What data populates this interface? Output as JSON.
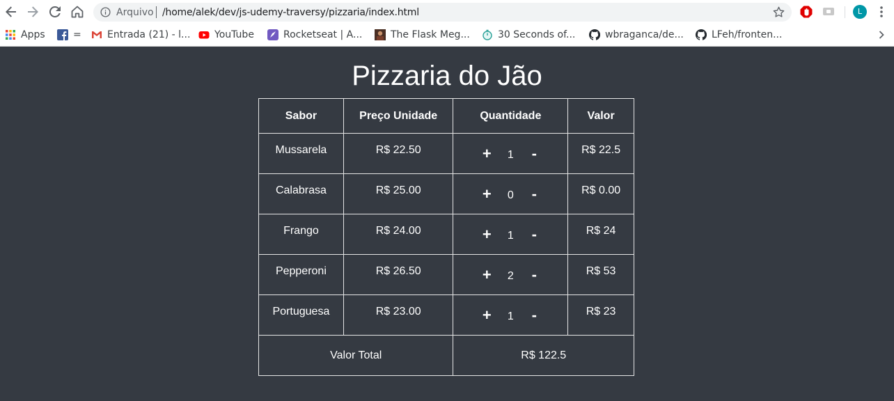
{
  "browser": {
    "omnibox_label": "Arquivo",
    "url": "/home/alek/dev/js-udemy-traversy/pizzaria/index.html",
    "profile_initial": "L",
    "bookmarks": [
      {
        "label": "Apps",
        "icon": "apps-grid-icon"
      },
      {
        "label": "=",
        "icon": "facebook-icon"
      },
      {
        "label": "Entrada (21) - l...",
        "icon": "gmail-icon"
      },
      {
        "label": "YouTube",
        "icon": "youtube-icon"
      },
      {
        "label": "Rocketseat | A...",
        "icon": "rocketseat-icon"
      },
      {
        "label": "The Flask Meg...",
        "icon": "flask-mega-icon"
      },
      {
        "label": "30 Seconds of...",
        "icon": "stopwatch-icon"
      },
      {
        "label": "wbraganca/de...",
        "icon": "github-icon"
      },
      {
        "label": "LFeh/fronten...",
        "icon": "github-icon"
      }
    ]
  },
  "page": {
    "title": "Pizzaria do Jão",
    "headers": {
      "sabor": "Sabor",
      "preco": "Preço Unidade",
      "quantidade": "Quantidade",
      "valor": "Valor"
    },
    "plus_label": "+",
    "minus_label": "-",
    "rows": [
      {
        "sabor": "Mussarela",
        "preco": "R$ 22.50",
        "quantidade": "1",
        "valor": "R$ 22.5"
      },
      {
        "sabor": "Calabrasa",
        "preco": "R$ 25.00",
        "quantidade": "0",
        "valor": "R$ 0.00"
      },
      {
        "sabor": "Frango",
        "preco": "R$ 24.00",
        "quantidade": "1",
        "valor": "R$ 24"
      },
      {
        "sabor": "Pepperoni",
        "preco": "R$ 26.50",
        "quantidade": "2",
        "valor": "R$ 53"
      },
      {
        "sabor": "Portuguesa",
        "preco": "R$ 23.00",
        "quantidade": "1",
        "valor": "R$ 23"
      }
    ],
    "total_label": "Valor Total",
    "total_value": "R$ 122.5"
  },
  "colors": {
    "page_background": "#353a42",
    "text": "#ffffff",
    "table_border": "#e6e6e6"
  }
}
